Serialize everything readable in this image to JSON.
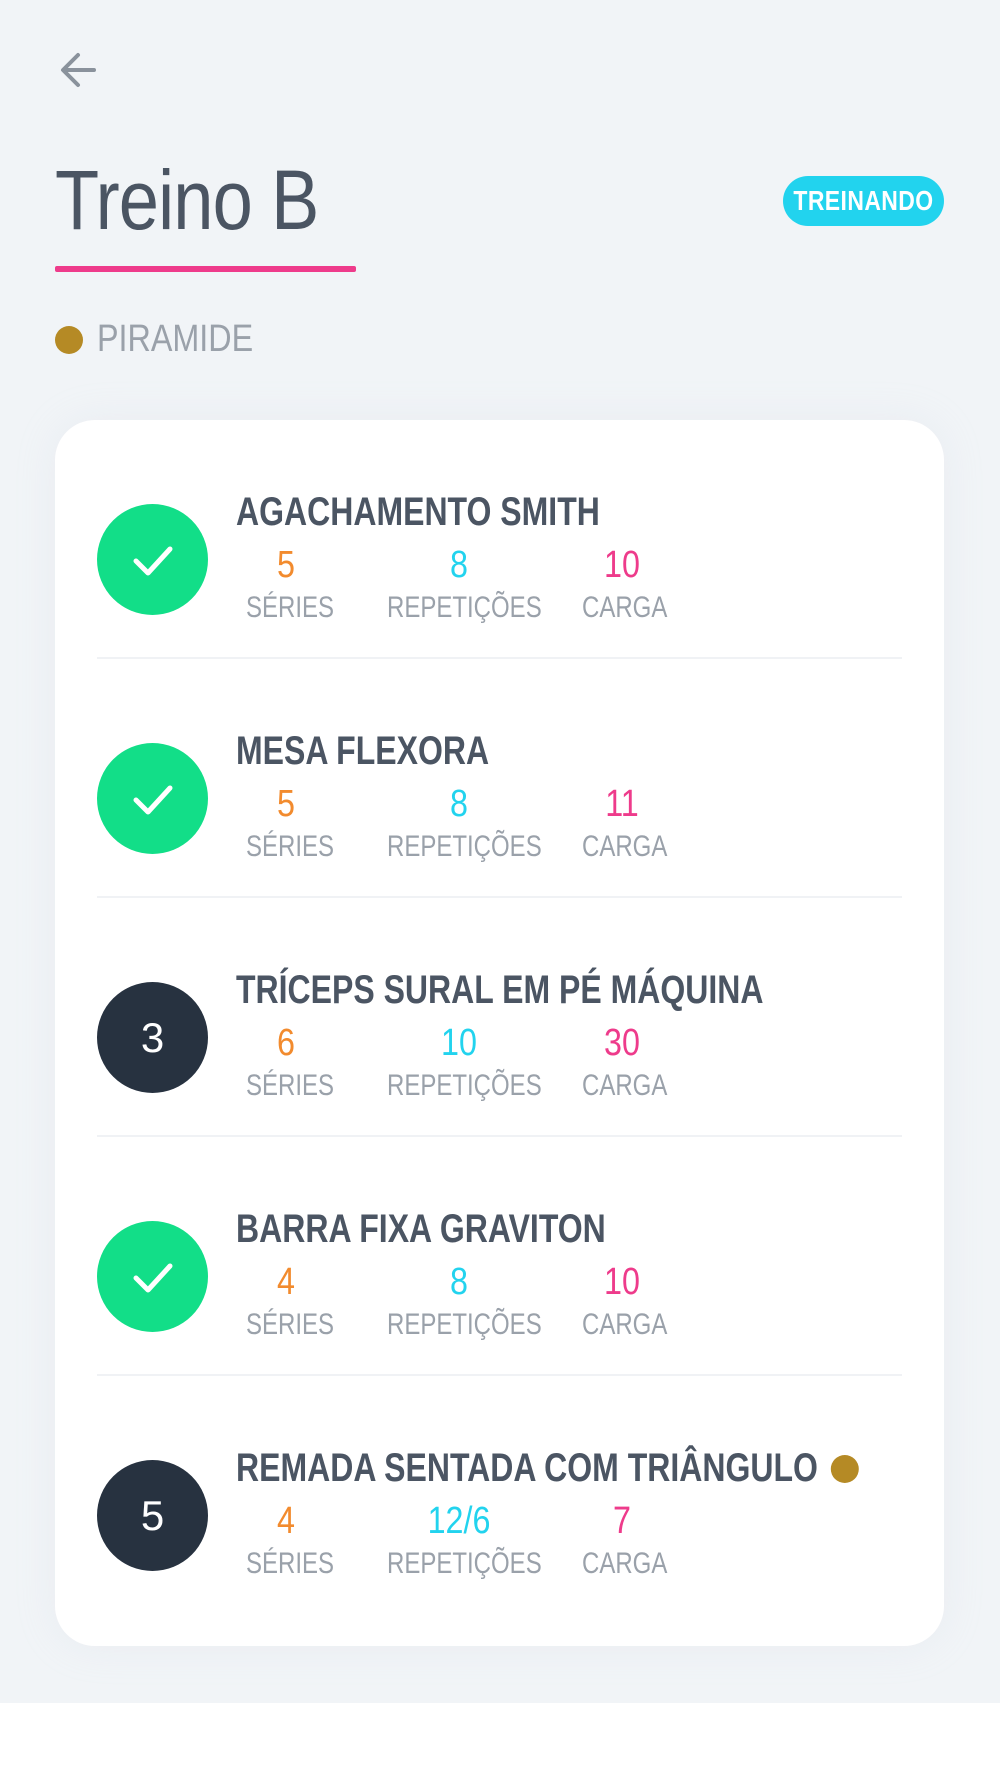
{
  "header": {
    "back_icon": "arrow-left-icon",
    "title": "Treino B",
    "status_badge": "TREINANDO"
  },
  "method": {
    "label": "PIRAMIDE",
    "dot_color": "#b58a25"
  },
  "colors": {
    "accent_pink": "#ee3b8b",
    "accent_cyan": "#22d3ee",
    "accent_orange": "#f28b2e",
    "done_green": "#12de88",
    "pending_dark": "#273240"
  },
  "stat_labels": {
    "series": "SÉRIES",
    "reps": "REPETIÇÕES",
    "load": "CARGA"
  },
  "exercises": [
    {
      "name": "AGACHAMENTO SMITH",
      "status": "done",
      "number": "",
      "series": "5",
      "reps": "8",
      "load": "10",
      "has_method_dot": false
    },
    {
      "name": "MESA FLEXORA",
      "status": "done",
      "number": "",
      "series": "5",
      "reps": "8",
      "load": "11",
      "has_method_dot": false
    },
    {
      "name": "TRÍCEPS SURAL EM PÉ MÁQUINA",
      "status": "pending",
      "number": "3",
      "series": "6",
      "reps": "10",
      "load": "30",
      "has_method_dot": false
    },
    {
      "name": "BARRA FIXA GRAVITON",
      "status": "done",
      "number": "",
      "series": "4",
      "reps": "8",
      "load": "10",
      "has_method_dot": false
    },
    {
      "name": "REMADA SENTADA COM TRIÂNGULO",
      "status": "pending",
      "number": "5",
      "series": "4",
      "reps": "12/6",
      "load": "7",
      "has_method_dot": true
    }
  ]
}
